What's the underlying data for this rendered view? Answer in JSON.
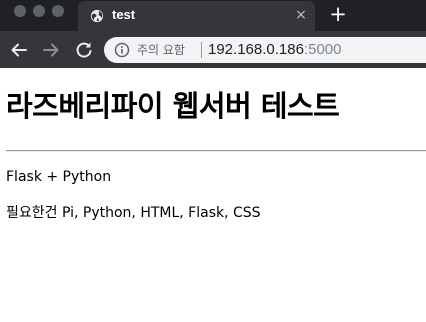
{
  "browser": {
    "tab": {
      "title": "test",
      "close_label": "×",
      "favicon": "globe-icon"
    },
    "new_tab_label": "+",
    "toolbar": {
      "back_icon": "arrow-left-icon",
      "forward_icon": "arrow-right-icon",
      "reload_icon": "reload-icon",
      "security_icon": "info-icon",
      "security_label": "주의 요함",
      "url_host": "192.168.0.186",
      "url_port": ":5000"
    }
  },
  "page": {
    "title": "라즈베리파이 웹서버 테스트",
    "paragraphs": [
      "Flask + Python",
      "필요한건 Pi, Python, HTML, Flask, CSS"
    ]
  }
}
